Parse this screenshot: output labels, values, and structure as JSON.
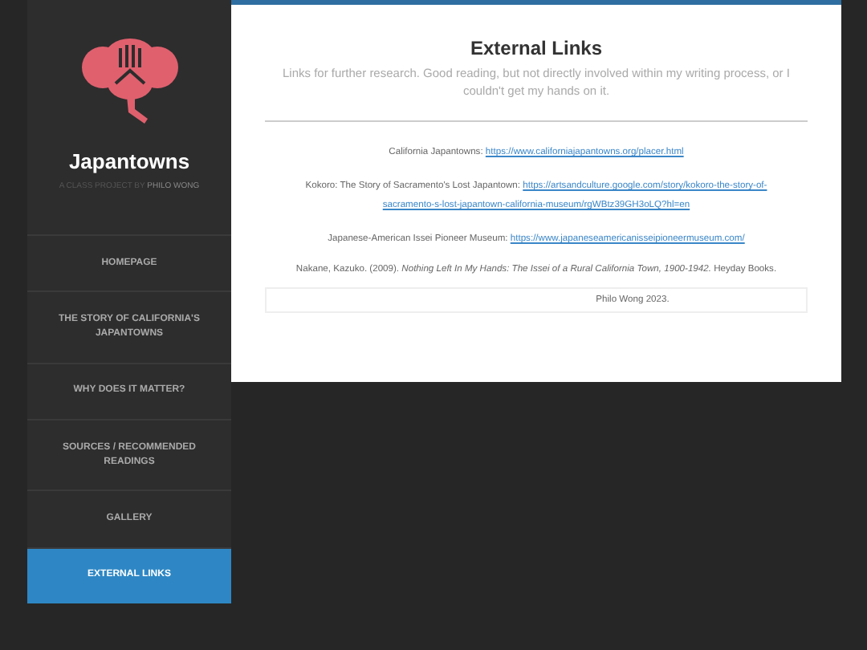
{
  "site": {
    "title": "Japantowns",
    "tagline": "A CLASS PROJECT BY ",
    "author": "PHILO WONG"
  },
  "nav": [
    {
      "label": "HOMEPAGE",
      "selected": false
    },
    {
      "label": "THE STORY OF CALIFORNIA'S JAPANTOWNS",
      "selected": false
    },
    {
      "label": "WHY DOES IT MATTER?",
      "selected": false
    },
    {
      "label": "SOURCES / RECOMMENDED READINGS",
      "selected": false
    },
    {
      "label": "GALLERY",
      "selected": false
    },
    {
      "label": "EXTERNAL LINKS",
      "selected": true
    }
  ],
  "page": {
    "title": "External Links",
    "intro": "Links for further research. Good reading, but not directly involved within my writing process, or I couldn't get my hands on it."
  },
  "entries": [
    {
      "kind": "link",
      "label": "California Japantowns: ",
      "url": "https://www.californiajapantowns.org/placer.html"
    },
    {
      "kind": "link",
      "label": "Kokoro: The Story of Sacramento's Lost Japantown: ",
      "url": "https://artsandculture.google.com/story/kokoro-the-story-of-",
      "url_continued": "sacramento-s-lost-japantown-california-museum/rgWBtz39GH3oLQ?hl=en"
    },
    {
      "kind": "link",
      "label": "Japanese-American Issei Pioneer Museum: ",
      "url": "https://www.japaneseamericanisseipioneermuseum.com/"
    },
    {
      "kind": "citation",
      "text": "Nakane, Kazuko. (2009). *Nothing Left In My Hands: The Issei of a Rural California Town, 1900-1942.* Heyday Books."
    }
  ],
  "footer": "Philo Wong 2023."
}
